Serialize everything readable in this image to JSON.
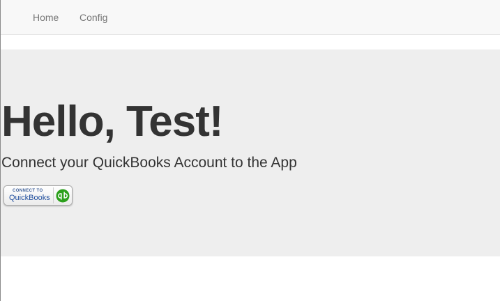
{
  "nav": {
    "items": [
      {
        "label": "Home"
      },
      {
        "label": "Config"
      }
    ]
  },
  "hero": {
    "title": "Hello, Test!",
    "subtitle": "Connect your QuickBooks Account to the App"
  },
  "qb_button": {
    "connect_text": "CONNECT TO",
    "brand_text": "QuickBooks",
    "logo_icon": "quickbooks-logo-icon",
    "brand_color": "#2ca01c"
  }
}
